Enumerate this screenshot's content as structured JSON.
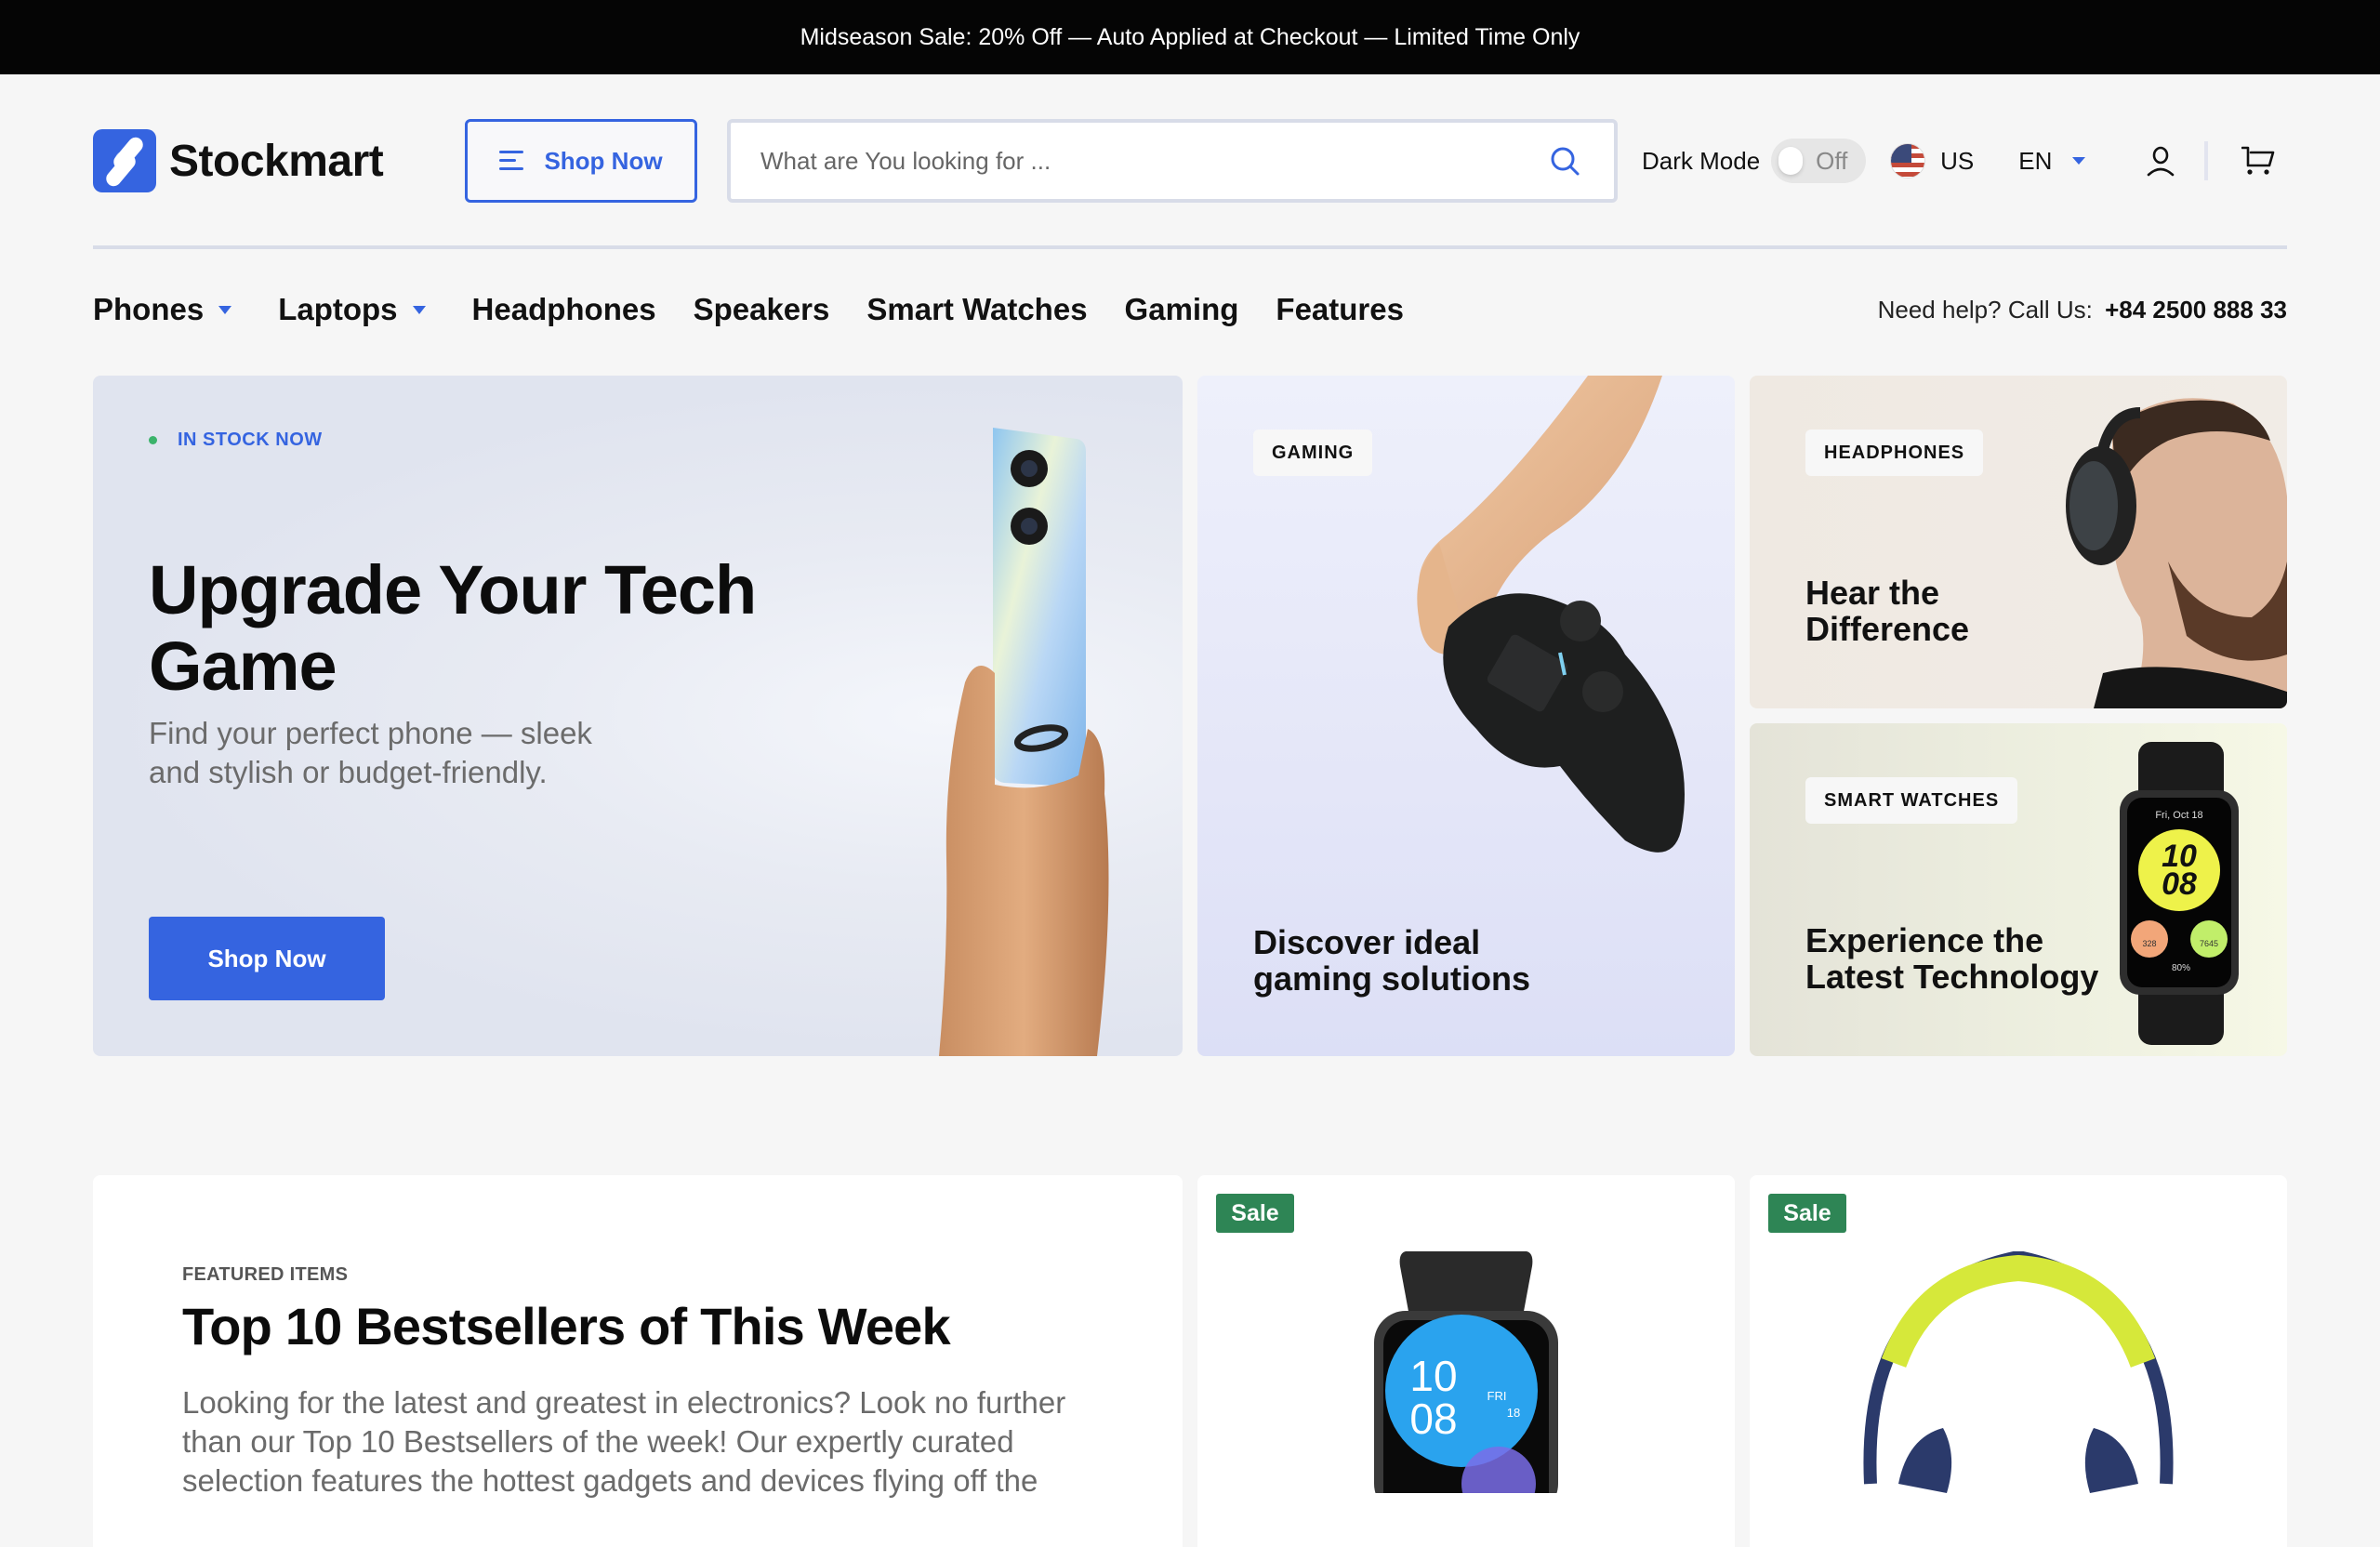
{
  "announcement": "Midseason Sale: 20% Off — Auto Applied at Checkout — Limited Time Only",
  "brand": {
    "name": "Stockmart",
    "accent": "#3564e0"
  },
  "header": {
    "shop_now_label": "Shop Now",
    "search": {
      "placeholder": "What are You looking for ...",
      "value": ""
    },
    "dark_mode": {
      "label": "Dark Mode",
      "state": "Off"
    },
    "region": "US",
    "language": "EN",
    "icons": [
      "menu-icon",
      "search-icon",
      "flag-us-icon",
      "user-icon",
      "cart-icon"
    ]
  },
  "nav": {
    "items": [
      {
        "label": "Phones",
        "dropdown": true
      },
      {
        "label": "Laptops",
        "dropdown": true
      },
      {
        "label": "Headphones",
        "dropdown": false
      },
      {
        "label": "Speakers",
        "dropdown": false
      },
      {
        "label": "Smart Watches",
        "dropdown": false
      },
      {
        "label": "Gaming",
        "dropdown": false
      },
      {
        "label": "Features",
        "dropdown": false
      }
    ],
    "help_label": "Need help? Call Us:",
    "help_phone": "+84 2500 888 33"
  },
  "hero": {
    "badge": "IN STOCK NOW",
    "title": "Upgrade Your Tech Game",
    "subtitle": "Find your perfect phone — sleek and stylish or budget-friendly.",
    "cta": "Shop Now"
  },
  "promos": [
    {
      "tag": "GAMING",
      "title": "Discover ideal gaming solutions"
    },
    {
      "tag": "HEADPHONES",
      "title": "Hear the Difference"
    },
    {
      "tag": "SMART WATCHES",
      "title": "Experience the Latest Technology",
      "watch_face": {
        "date": "Fri, Oct 18",
        "hour": "10",
        "minute": "08",
        "calories": "328",
        "steps": "7645",
        "battery": "80%"
      }
    }
  ],
  "featured": {
    "eyebrow": "FEATURED ITEMS",
    "title": "Top 10 Bestsellers of This Week",
    "body": "Looking for the latest and greatest in electronics? Look no further than our Top 10 Bestsellers of the week! Our expertly curated selection features the hottest gadgets and devices flying off the"
  },
  "products": [
    {
      "badge": "Sale",
      "image": "smart-watch",
      "face": {
        "hour": "10",
        "minute": "08",
        "day": "FRI",
        "date": "18"
      }
    },
    {
      "badge": "Sale",
      "image": "headphones"
    }
  ],
  "colors": {
    "sale_badge": "#2e8555",
    "in_stock_dot": "#3bb36b",
    "topbar": "#050505",
    "page_bg": "#f6f6f6"
  }
}
